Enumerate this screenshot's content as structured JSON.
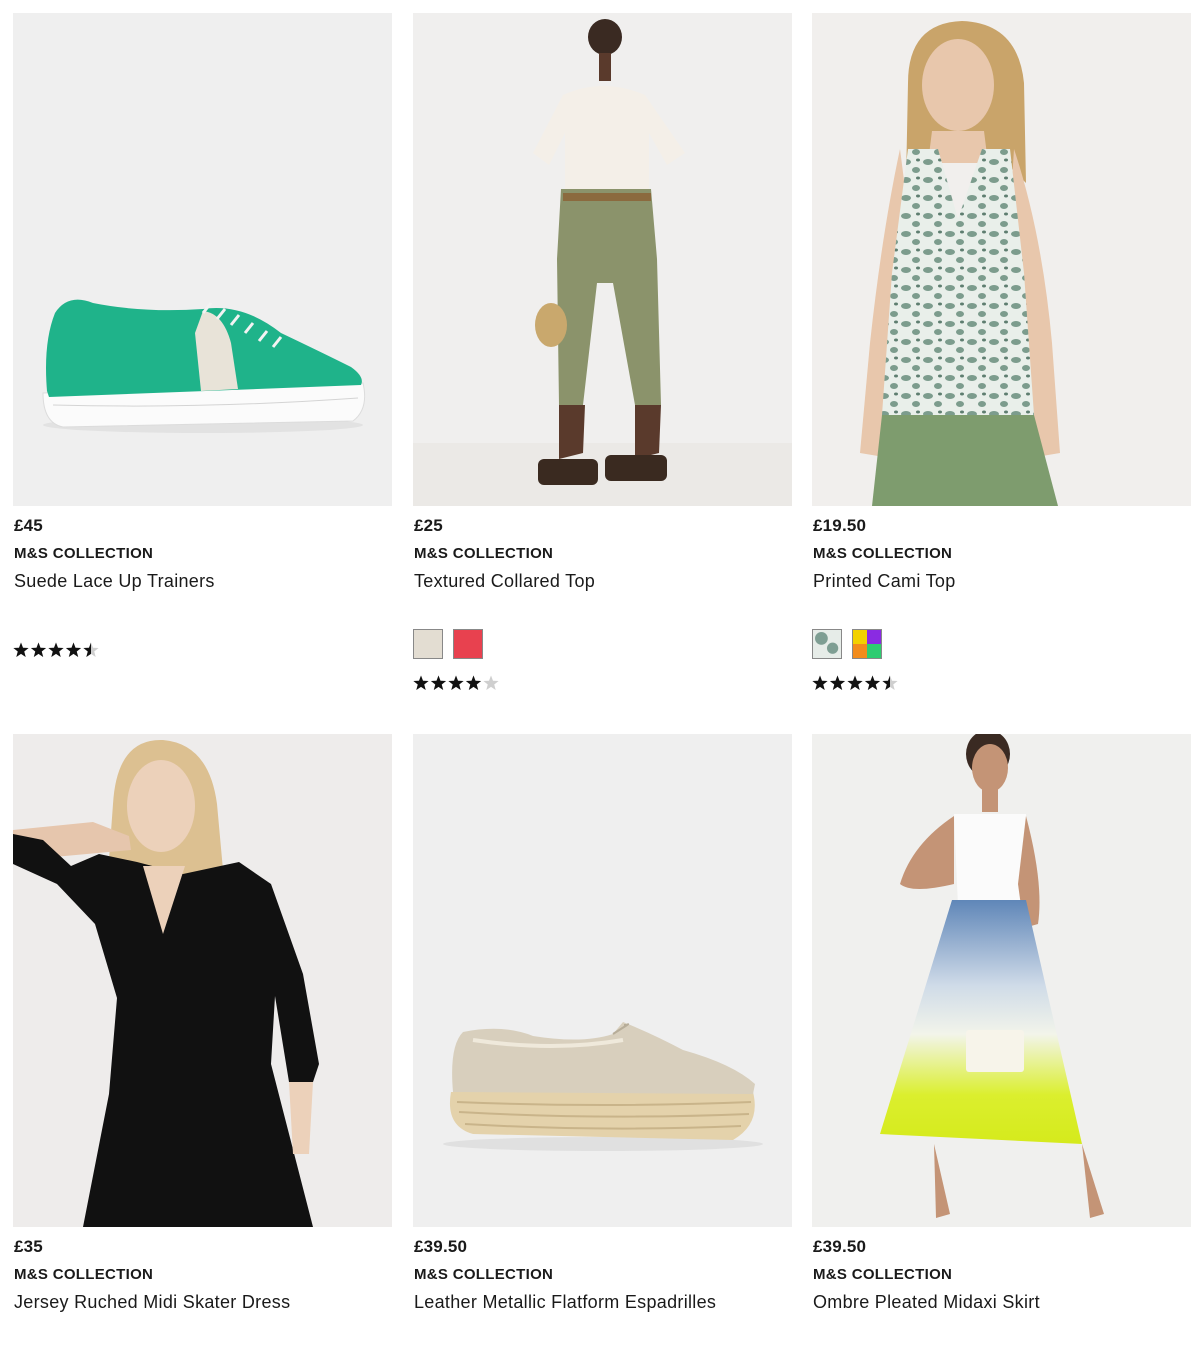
{
  "products": [
    {
      "price": "£45",
      "brand": "M&S COLLECTION",
      "title": "Suede Lace Up Trainers",
      "rating": 4.5,
      "image": "green-suede-trainer",
      "swatches": []
    },
    {
      "price": "£25",
      "brand": "M&S COLLECTION",
      "title": "Textured Collared Top",
      "rating": 4.0,
      "image": "woman-cream-polo-khaki-trousers",
      "swatches": [
        {
          "name": "cream-swatch",
          "color": "#e3ddd2"
        },
        {
          "name": "coral-swatch",
          "color": "#e8414f"
        }
      ]
    },
    {
      "price": "£19.50",
      "brand": "M&S COLLECTION",
      "title": "Printed Cami Top",
      "rating": 4.5,
      "image": "woman-leopard-print-cami",
      "swatches": [
        {
          "name": "leopard-green-swatch",
          "color": "#7e9e93"
        },
        {
          "name": "multicolour-swatch",
          "color": "#f2d100"
        }
      ]
    },
    {
      "price": "£35",
      "brand": "M&S COLLECTION",
      "title": "Jersey Ruched Midi Skater Dress",
      "image": "woman-black-ruched-dress",
      "swatches": []
    },
    {
      "price": "£39.50",
      "brand": "M&S COLLECTION",
      "title": "Leather Metallic Flatform Espadrilles",
      "image": "gold-metallic-espadrille",
      "swatches": []
    },
    {
      "price": "£39.50",
      "brand": "M&S COLLECTION",
      "title": "Ombre Pleated Midaxi Skirt",
      "image": "woman-ombre-pleated-skirt",
      "swatches": []
    }
  ]
}
